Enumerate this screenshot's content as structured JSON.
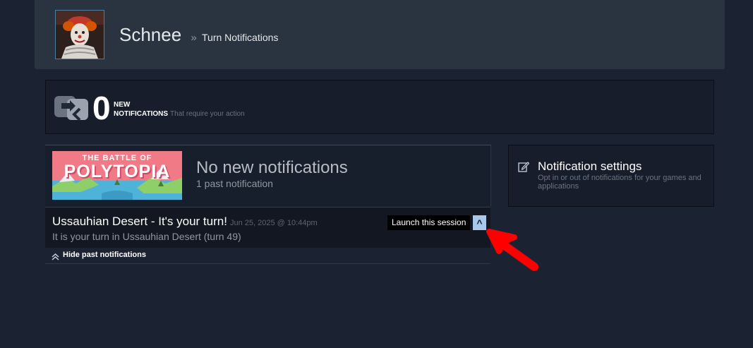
{
  "header": {
    "persona_name": "Schnee",
    "separator": "»",
    "breadcrumb": "Turn Notifications"
  },
  "summary": {
    "count": "0",
    "line1": "NEW",
    "line2": "NOTIFICATIONS",
    "description": "That require your action"
  },
  "game": {
    "capsule_line1": "THE BATTLE OF",
    "capsule_line2": "POLYTOPIA",
    "status": "No new notifications",
    "past_count": "1 past notification",
    "notification": {
      "title": "Ussauhian Desert - It's your turn!",
      "timestamp": "Jun 25, 2025 @ 10:44pm",
      "body": "It is your turn in Ussauhian Desert (turn 49)",
      "launch_label": "Launch this session",
      "collapse_label": "^"
    },
    "hide_label": "Hide past notifications"
  },
  "settings": {
    "title": "Notification settings",
    "description": "Opt in or out of notifications for your games and applications"
  },
  "colors": {
    "background": "#1b2332",
    "header": "#2a3441",
    "accent_button": "#a9c7e8",
    "annotation_arrow": "#ff0000"
  },
  "icons": {
    "summary": "turn-notification-icon",
    "settings": "pencil-edit-icon",
    "hide": "double-chevron-up-icon",
    "annotation": "red-arrow-annotation"
  }
}
